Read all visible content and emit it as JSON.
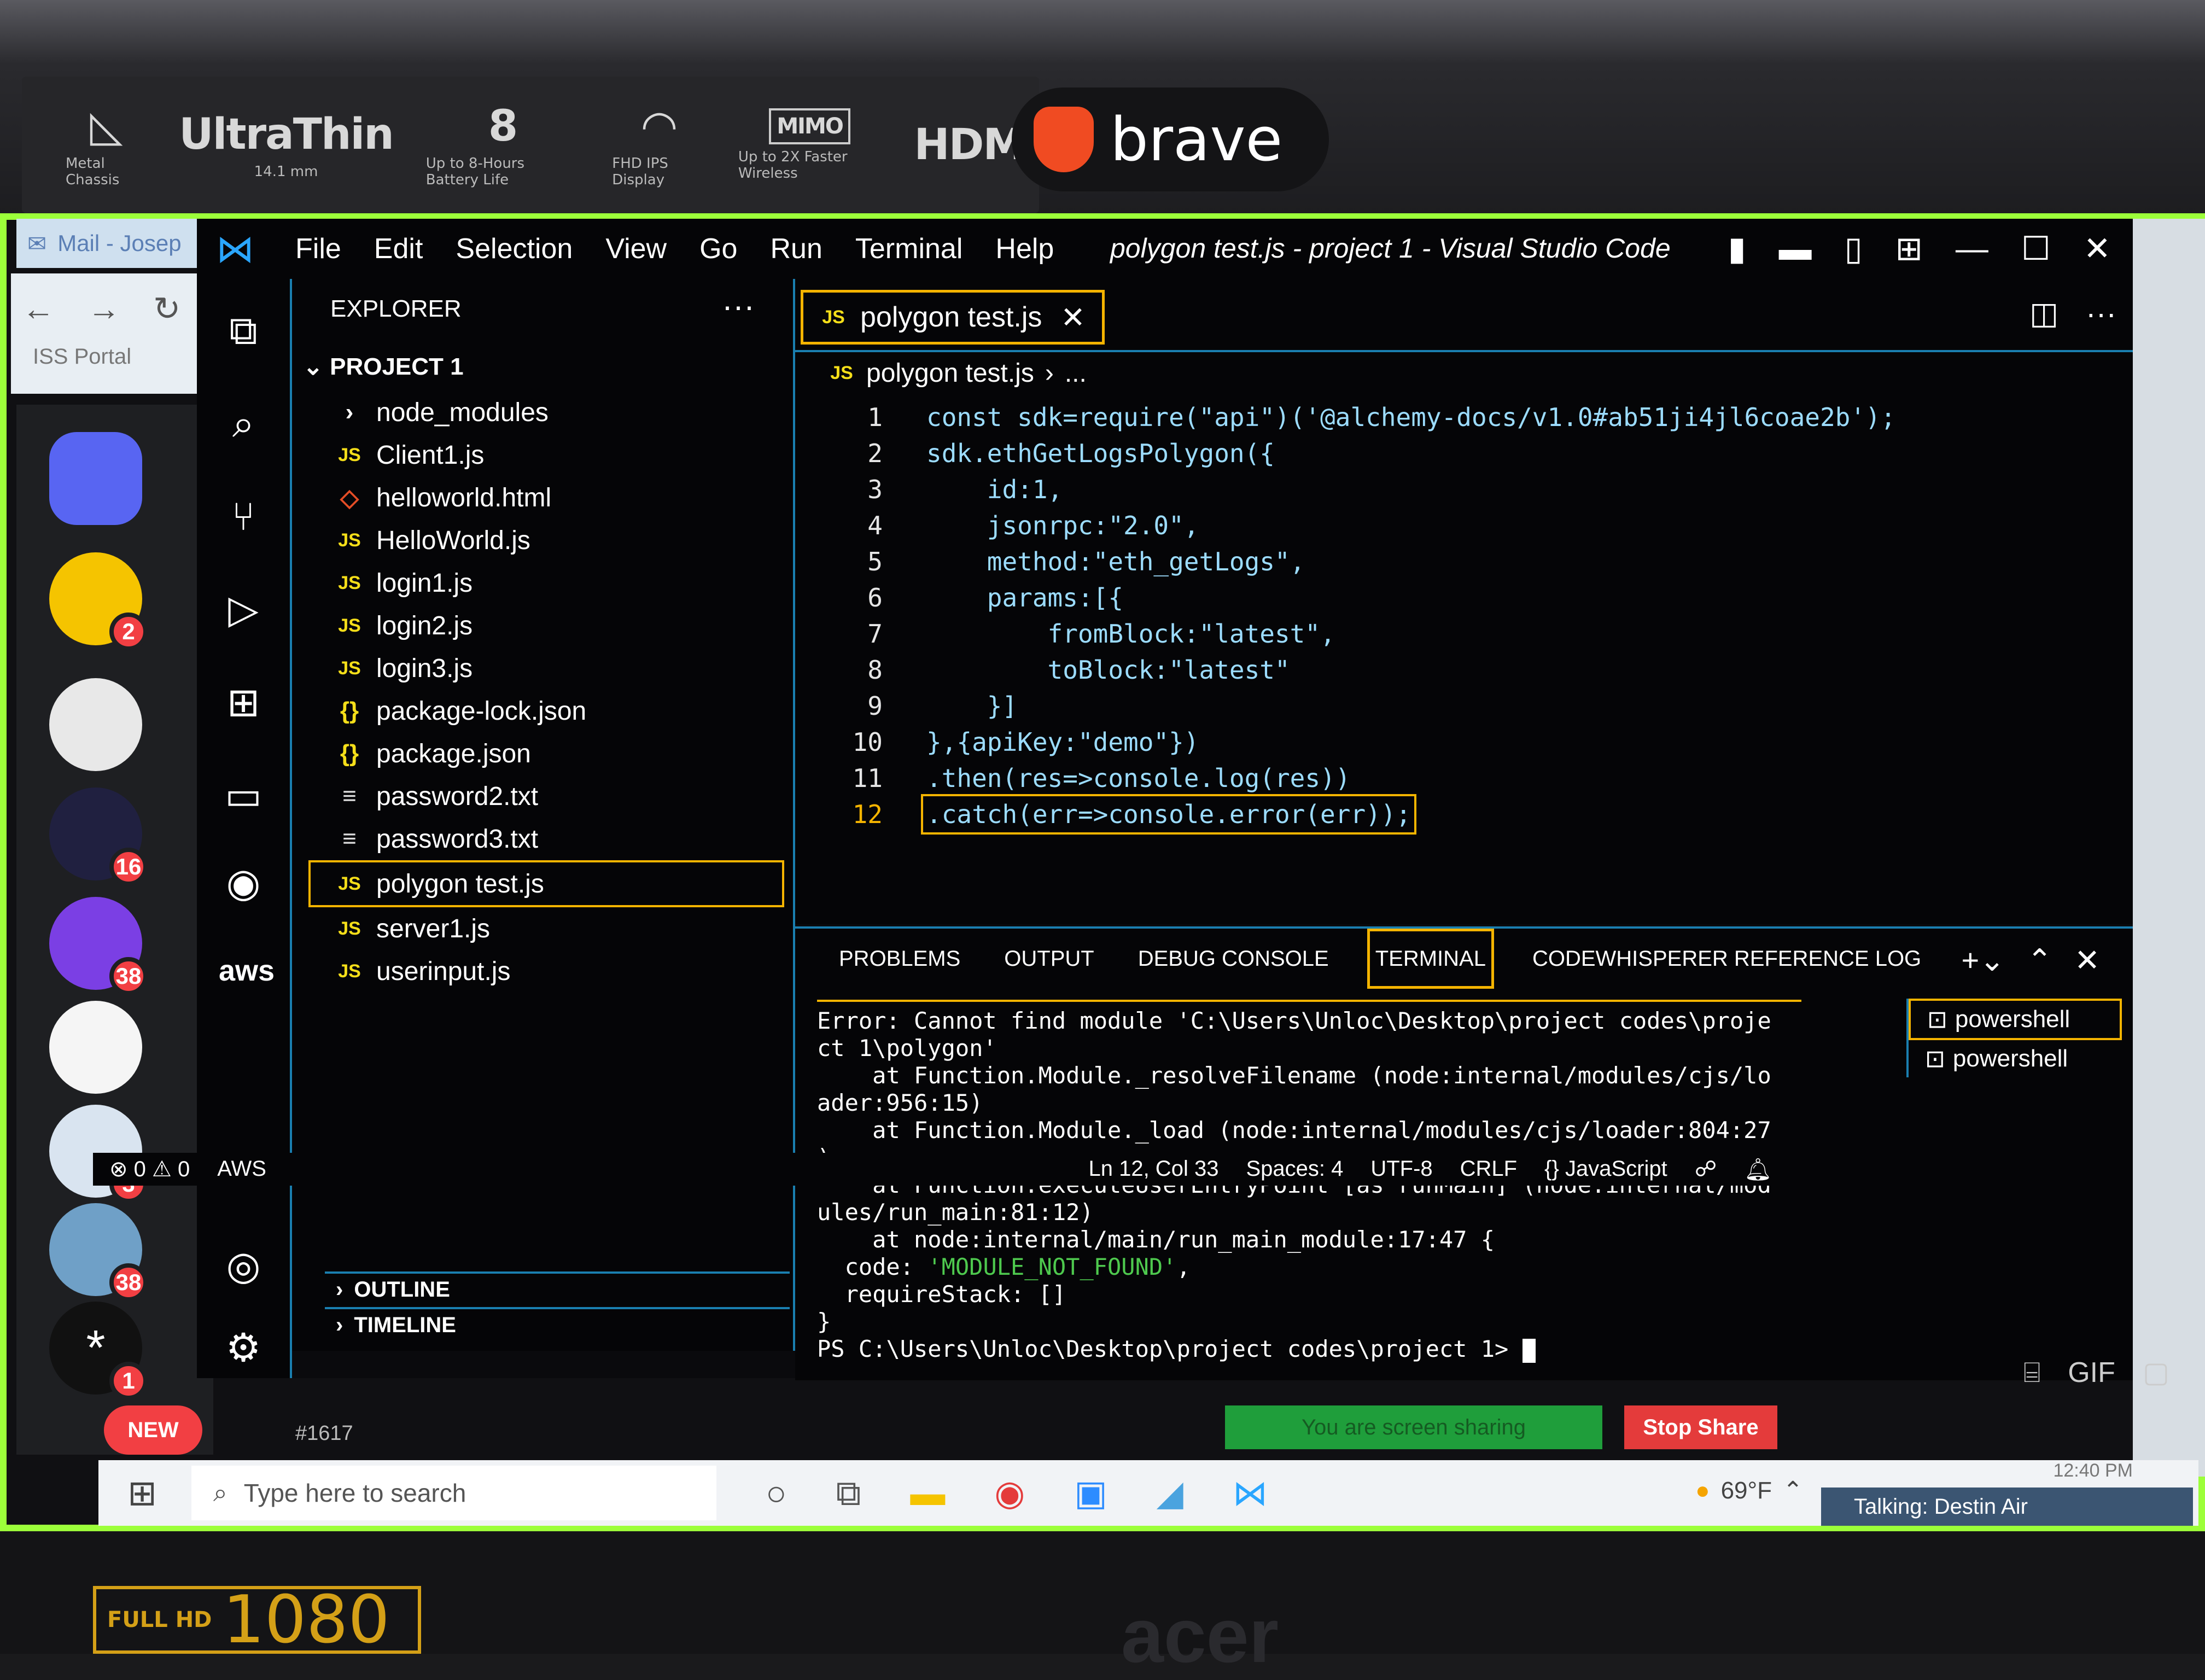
{
  "stickers": {
    "metal": "Metal Chassis",
    "ultrathin_big": "UltraThin",
    "ultrathin_small": "14.1 mm",
    "battery_big": "8",
    "battery_small": "Up to 8-Hours Battery Life",
    "display_small": "FHD IPS Display",
    "mimo_big": "MIMO",
    "mimo_small": "Up to 2X Faster Wireless",
    "hdmi_big": "HDMI",
    "brave": "brave"
  },
  "browser": {
    "tab_label": "Mail - Josep",
    "bookmark": "ISS Portal"
  },
  "discord": {
    "badges": [
      "2",
      "16",
      "38",
      "3",
      "38",
      "1"
    ],
    "new_label": "NEW",
    "user_tag": "#1617"
  },
  "vscode": {
    "menu": [
      "File",
      "Edit",
      "Selection",
      "View",
      "Go",
      "Run",
      "Terminal",
      "Help"
    ],
    "window_title": "polygon test.js - project 1 - Visual Studio Code",
    "explorer_title": "EXPLORER",
    "project": "PROJECT 1",
    "files": [
      {
        "name": "node_modules",
        "icon": "folder-chevron"
      },
      {
        "name": "Client1.js",
        "icon": "js"
      },
      {
        "name": "helloworld.html",
        "icon": "html"
      },
      {
        "name": "HelloWorld.js",
        "icon": "js"
      },
      {
        "name": "login1.js",
        "icon": "js"
      },
      {
        "name": "login2.js",
        "icon": "js"
      },
      {
        "name": "login3.js",
        "icon": "js"
      },
      {
        "name": "package-lock.json",
        "icon": "json"
      },
      {
        "name": "package.json",
        "icon": "json"
      },
      {
        "name": "password2.txt",
        "icon": "txt"
      },
      {
        "name": "password3.txt",
        "icon": "txt"
      },
      {
        "name": "polygon test.js",
        "icon": "js",
        "selected": true
      },
      {
        "name": "server1.js",
        "icon": "js"
      },
      {
        "name": "userinput.js",
        "icon": "js"
      }
    ],
    "outline": "OUTLINE",
    "timeline": "TIMELINE",
    "tab_label": "polygon test.js",
    "breadcrumb_file": "polygon test.js",
    "breadcrumb_more": "...",
    "code_lines": [
      "const sdk=require(\"api\")('@alchemy-docs/v1.0#ab51ji4jl6coae2b');",
      "sdk.ethGetLogsPolygon({",
      "    id:1,",
      "    jsonrpc:\"2.0\",",
      "    method:\"eth_getLogs\",",
      "    params:[{",
      "        fromBlock:\"latest\",",
      "        toBlock:\"latest\"",
      "    }]",
      "},{apiKey:\"demo\"})",
      ".then(res=>console.log(res))",
      ".catch(err=>console.error(err));"
    ],
    "current_line": 12,
    "panel_tabs": [
      "PROBLEMS",
      "OUTPUT",
      "DEBUG CONSOLE",
      "TERMINAL",
      "CODEWHISPERER REFERENCE LOG"
    ],
    "active_panel_tab": "TERMINAL",
    "terminal": {
      "line1": "Error: Cannot find module 'C:\\Users\\Unloc\\Desktop\\project codes\\proje\nct 1\\polygon'",
      "line2": "    at Function.Module._resolveFilename (node:internal/modules/cjs/lo\nader:956:15)",
      "line3": "    at Function.Module._load (node:internal/modules/cjs/loader:804:27\n)",
      "line4": "    at Function.executeUserEntryPoint [as runMain] (node:internal/mod\nules/run_main:81:12)",
      "line5": "    at node:internal/main/run_main_module:17:47 {",
      "code_key": "  code: ",
      "code_val": "'MODULE_NOT_FOUND'",
      "code_end": ",",
      "require": "  requireStack: []",
      "close": "}",
      "prompt": "PS C:\\Users\\Unloc\\Desktop\\project codes\\project 1> "
    },
    "shells": [
      "powershell",
      "powershell"
    ],
    "status": {
      "errors": "0",
      "warnings": "0",
      "aws": "AWS",
      "position": "Ln 12, Col 33",
      "spaces": "Spaces: 4",
      "encoding": "UTF-8",
      "eol": "CRLF",
      "language": "JavaScript"
    }
  },
  "share": {
    "message": "You are screen sharing",
    "stop": "Stop Share"
  },
  "taskbar": {
    "search_placeholder": "Type here to search",
    "temp": "69°F",
    "time": "12:40 PM",
    "talking": "Talking: Destin Air"
  },
  "laptop": {
    "fullhd": "FULL HD",
    "res": "1080",
    "brand": "acer"
  }
}
